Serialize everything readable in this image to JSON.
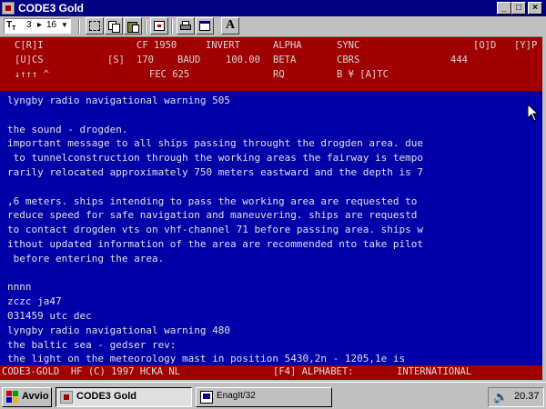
{
  "window": {
    "title": "CODE3 Gold",
    "min": "_",
    "max": "□",
    "close": "×"
  },
  "toolbar": {
    "font_size_label": "3",
    "font_size_value": "16",
    "bold_label": "A"
  },
  "status": {
    "row1": [
      "C[R]I",
      "CF 1950",
      "INVERT",
      "ALPHA",
      "SYNC",
      "[O]D",
      "[Y]P"
    ],
    "row2": [
      "[U]CS",
      "[S]",
      "170",
      "BAUD",
      "100.00",
      "BETA",
      "CBRS",
      "444"
    ],
    "row3": [
      "↓↑↑↑ ^",
      "FEC 625",
      "RQ",
      "B ¥ [A]TC"
    ]
  },
  "main": {
    "lines": [
      "lyngby radio navigational warning 505",
      "",
      "the sound - drogden.",
      "important message to all ships passing throught the drogden area. due",
      " to tunnelconstruction through the working areas the fairway is tempo",
      "rarily relocated approximately 750 meters eastward and the depth is 7",
      "",
      ",6 meters. ships intending to pass the working area are requested to",
      "reduce speed for safe navigation and maneuvering. ships are requestd",
      "to contact drogden vts on vhf-channel 71 before passing area. ships w",
      "ithout updated information of the area are recommended nto take pilot",
      " before entering the area.",
      "",
      "nnnn",
      "zczc ja47",
      "031459 utc dec",
      "lyngby radio navigational warning 480",
      "the baltic sea - gedser rev:",
      "the light on the meteorology mast in position 5430,2n - 1205,1e is"
    ]
  },
  "bottombar": {
    "left": "CODE3-GOLD  HF (C) 1997 HCKA NL",
    "hotkey": "[F4] ALPHABET:",
    "alphabet": "INTERNATIONAL"
  },
  "taskbar": {
    "start_label": "Avvio",
    "tasks": [
      "CODE3 Gold",
      "EnagIt/32"
    ],
    "clock": "20.37"
  },
  "colors": {
    "main_bg": "#0000a8",
    "status_bg": "#a00000",
    "title_bg": "#000080"
  }
}
